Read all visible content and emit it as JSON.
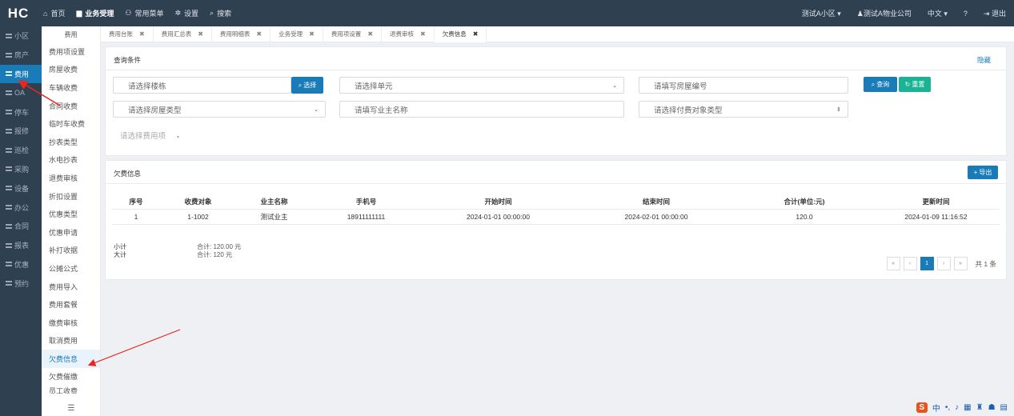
{
  "app": {
    "logo": "HC"
  },
  "topnav": [
    {
      "icon": "home-icon",
      "glyph": "⌂",
      "label": "首页"
    },
    {
      "icon": "monitor-icon",
      "glyph": "▆",
      "label": "业务受理"
    },
    {
      "icon": "sitemap-icon",
      "glyph": "⚇",
      "label": "常用菜单"
    },
    {
      "icon": "gear-icon",
      "glyph": "✲",
      "label": "设置"
    },
    {
      "icon": "search-icon",
      "glyph": "⌕",
      "label": "搜索"
    }
  ],
  "topright": {
    "community": "测试A小区",
    "company": "测试A物业公司",
    "lang": "中文",
    "help": "?",
    "logout": "退出"
  },
  "sidebar1": [
    "小区",
    "房产",
    "费用",
    "OA",
    "停车",
    "报修",
    "巡检",
    "采购",
    "设备",
    "办公",
    "合同",
    "报表",
    "优惠",
    "预约"
  ],
  "sidebar2": {
    "head": "费用",
    "items": [
      "费用项设置",
      "房屋收费",
      "车辆收费",
      "合同收费",
      "临时车收费",
      "抄表类型",
      "水电抄表",
      "退费审核",
      "折扣设置",
      "优惠类型",
      "优惠申请",
      "补打收据",
      "公摊公式",
      "费用导入",
      "费用套餐",
      "缴费审核",
      "取消费用",
      "欠费信息",
      "欠费催缴",
      "员工收费"
    ],
    "foot": "☰"
  },
  "tabs": [
    {
      "label": "费用台账"
    },
    {
      "label": "费用汇总表"
    },
    {
      "label": "费用明细表"
    },
    {
      "label": "业务受理"
    },
    {
      "label": "费用项设置"
    },
    {
      "label": "退费审核"
    },
    {
      "label": "欠费信息"
    }
  ],
  "query": {
    "title": "查询条件",
    "hide": "隐藏",
    "building": "请选择楼栋",
    "select_btn": "选择",
    "unit": "请选择单元",
    "room_no": "请填写房屋编号",
    "search_btn": "查询",
    "reset_btn": "重置",
    "room_type": "请选择房屋类型",
    "owner": "请填写业主名称",
    "payer_type": "请选择付费对象类型",
    "fee_item": "请选择费用项"
  },
  "owed": {
    "title": "欠费信息",
    "export_btn": "导出",
    "columns": [
      "序号",
      "收费对象",
      "业主名称",
      "手机号",
      "开始时间",
      "结束时间",
      "合计(单位:元)",
      "更新时间"
    ],
    "rows": [
      [
        "1",
        "1-1002",
        "测试业主",
        "18911111111",
        "2024-01-01 00:00:00",
        "2024-02-01 00:00:00",
        "120.0",
        "2024-01-09 11:16:52"
      ]
    ],
    "subtotal_label": "小计",
    "subtotal_value": "合计: 120.00 元",
    "total_label": "大计",
    "total_value": "合计: 120 元",
    "pager": {
      "first": "«",
      "prev": "‹",
      "page": "1",
      "next": "›",
      "last": "»",
      "total": "共 1 条"
    }
  },
  "colors": {
    "sidebar": "#2f4050",
    "accent": "#1a7bb9",
    "teal": "#1ab394",
    "annotation": "#e8281e"
  }
}
